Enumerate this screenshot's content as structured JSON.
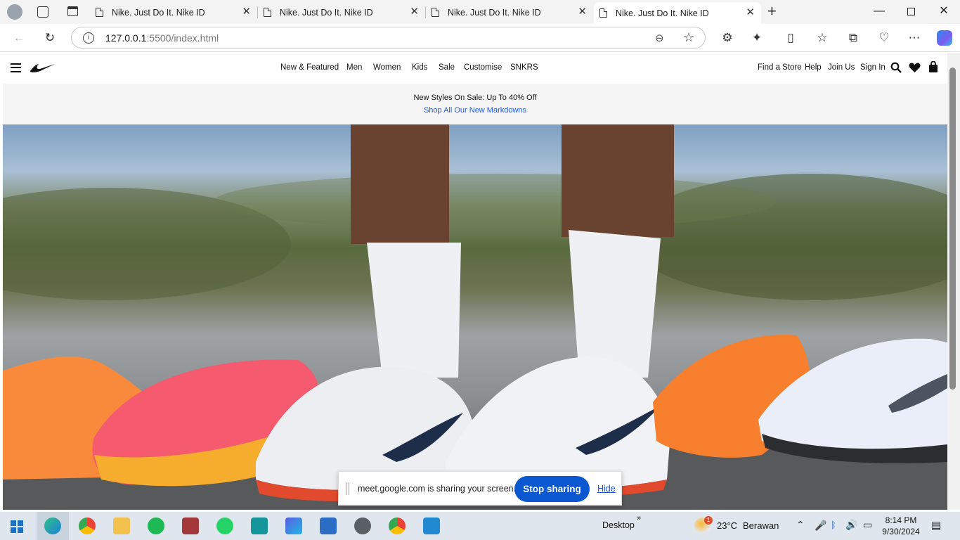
{
  "browser": {
    "tabs": [
      {
        "title": "Nike. Just Do It. Nike ID"
      },
      {
        "title": "Nike. Just Do It. Nike ID"
      },
      {
        "title": "Nike. Just Do It. Nike ID"
      },
      {
        "title": "Nike. Just Do It. Nike ID"
      }
    ],
    "url_host": "127.0.0.1",
    "url_path": ":5500/index.html"
  },
  "nav": {
    "links": [
      "New & Featured",
      "Men",
      "Women",
      "Kids",
      "Sale",
      "Customise",
      "SNKRS"
    ],
    "right_links": [
      "Find a Store",
      "Help",
      "Join Us",
      "Sign In"
    ]
  },
  "banner": {
    "headline": "New Styles On Sale: Up To 40% Off",
    "link": "Shop All Our New Markdowns"
  },
  "hero": {
    "description_icon": "running-shoes-photo"
  },
  "share": {
    "message": "meet.google.com is sharing your screen.",
    "stop_label": "Stop sharing",
    "hide_label": "Hide"
  },
  "taskbar": {
    "desktop_label": "Desktop",
    "weather_temp": "23°C",
    "weather_desc": "Berawan",
    "weather_badge": "1",
    "time": "8:14 PM",
    "date": "9/30/2024"
  }
}
